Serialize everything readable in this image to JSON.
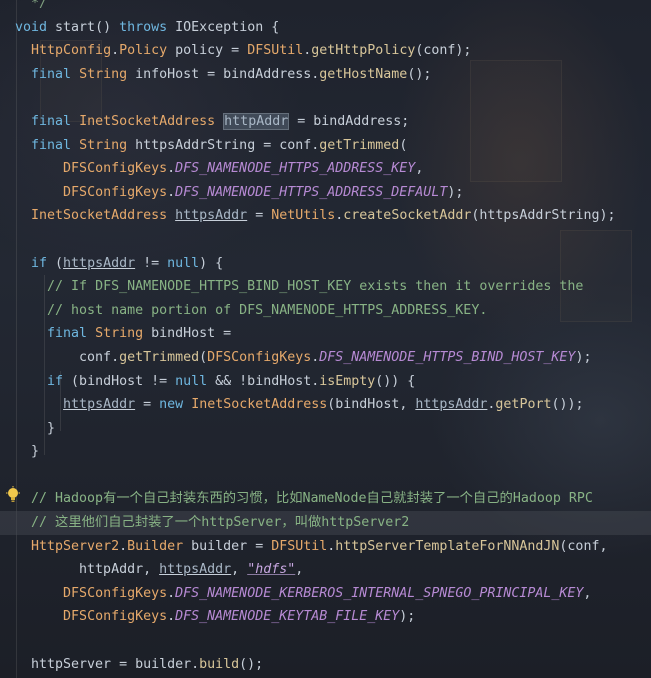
{
  "code_lines": [
    [
      {
        "t": "  */",
        "c": "cm"
      }
    ],
    [
      {
        "t": "void",
        "c": "kw"
      },
      {
        "t": " start() ",
        "c": "pl"
      },
      {
        "t": "throws",
        "c": "kw"
      },
      {
        "t": " IOException {",
        "c": "pl"
      }
    ],
    [
      {
        "t": "  ",
        "c": "pl"
      },
      {
        "t": "HttpConfig",
        "c": "ty"
      },
      {
        "t": ".",
        "c": "pl"
      },
      {
        "t": "Policy",
        "c": "ty"
      },
      {
        "t": " policy = ",
        "c": "pl"
      },
      {
        "t": "DFSUtil",
        "c": "ty"
      },
      {
        "t": ".",
        "c": "pl"
      },
      {
        "t": "getHttpPolicy",
        "c": "fn"
      },
      {
        "t": "(conf);",
        "c": "pl"
      }
    ],
    [
      {
        "t": "  ",
        "c": "pl"
      },
      {
        "t": "final",
        "c": "kw"
      },
      {
        "t": " ",
        "c": "pl"
      },
      {
        "t": "String",
        "c": "ty"
      },
      {
        "t": " infoHost = bindAddress.",
        "c": "pl"
      },
      {
        "t": "getHostName",
        "c": "fn"
      },
      {
        "t": "();",
        "c": "pl"
      }
    ],
    [
      {
        "t": "",
        "c": "pl"
      }
    ],
    [
      {
        "t": "  ",
        "c": "pl"
      },
      {
        "t": "final",
        "c": "kw"
      },
      {
        "t": " ",
        "c": "pl"
      },
      {
        "t": "InetSocketAddress",
        "c": "ty"
      },
      {
        "t": " ",
        "c": "pl"
      },
      {
        "t": "httpAddr",
        "c": "hl"
      },
      {
        "t": " = bindAddress;",
        "c": "pl"
      }
    ],
    [
      {
        "t": "  ",
        "c": "pl"
      },
      {
        "t": "final",
        "c": "kw"
      },
      {
        "t": " ",
        "c": "pl"
      },
      {
        "t": "String",
        "c": "ty"
      },
      {
        "t": " httpsAddrString = conf.",
        "c": "pl"
      },
      {
        "t": "getTrimmed",
        "c": "fn"
      },
      {
        "t": "(",
        "c": "pl"
      }
    ],
    [
      {
        "t": "      ",
        "c": "pl"
      },
      {
        "t": "DFSConfigKeys",
        "c": "ty"
      },
      {
        "t": ".",
        "c": "pl"
      },
      {
        "t": "DFS_NAMENODE_HTTPS_ADDRESS_KEY",
        "c": "cf"
      },
      {
        "t": ",",
        "c": "pl"
      }
    ],
    [
      {
        "t": "      ",
        "c": "pl"
      },
      {
        "t": "DFSConfigKeys",
        "c": "ty"
      },
      {
        "t": ".",
        "c": "pl"
      },
      {
        "t": "DFS_NAMENODE_HTTPS_ADDRESS_DEFAULT",
        "c": "cf"
      },
      {
        "t": ");",
        "c": "pl"
      }
    ],
    [
      {
        "t": "  ",
        "c": "pl"
      },
      {
        "t": "InetSocketAddress",
        "c": "ty"
      },
      {
        "t": " ",
        "c": "pl"
      },
      {
        "t": "httpsAddr",
        "c": "ul"
      },
      {
        "t": " = ",
        "c": "pl"
      },
      {
        "t": "NetUtils",
        "c": "ty"
      },
      {
        "t": ".",
        "c": "pl"
      },
      {
        "t": "createSocketAddr",
        "c": "fn"
      },
      {
        "t": "(httpsAddrString);",
        "c": "pl"
      }
    ],
    [
      {
        "t": "",
        "c": "pl"
      }
    ],
    [
      {
        "t": "  ",
        "c": "pl"
      },
      {
        "t": "if",
        "c": "kw"
      },
      {
        "t": " (",
        "c": "pl"
      },
      {
        "t": "httpsAddr",
        "c": "ul"
      },
      {
        "t": " != ",
        "c": "pl"
      },
      {
        "t": "null",
        "c": "nl"
      },
      {
        "t": ") {",
        "c": "pl"
      }
    ],
    [
      {
        "t": "    ",
        "c": "pl"
      },
      {
        "t": "// If DFS_NAMENODE_HTTPS_BIND_HOST_KEY exists then it overrides the",
        "c": "cmc"
      }
    ],
    [
      {
        "t": "    ",
        "c": "pl"
      },
      {
        "t": "// host name portion of DFS_NAMENODE_HTTPS_ADDRESS_KEY.",
        "c": "cmc"
      }
    ],
    [
      {
        "t": "    ",
        "c": "pl"
      },
      {
        "t": "final",
        "c": "kw"
      },
      {
        "t": " ",
        "c": "pl"
      },
      {
        "t": "String",
        "c": "ty"
      },
      {
        "t": " bindHost =",
        "c": "pl"
      }
    ],
    [
      {
        "t": "        conf.",
        "c": "pl"
      },
      {
        "t": "getTrimmed",
        "c": "fn"
      },
      {
        "t": "(",
        "c": "pl"
      },
      {
        "t": "DFSConfigKeys",
        "c": "ty"
      },
      {
        "t": ".",
        "c": "pl"
      },
      {
        "t": "DFS_NAMENODE_HTTPS_BIND_HOST_KEY",
        "c": "cf"
      },
      {
        "t": ");",
        "c": "pl"
      }
    ],
    [
      {
        "t": "    ",
        "c": "pl"
      },
      {
        "t": "if",
        "c": "kw"
      },
      {
        "t": " (bindHost != ",
        "c": "pl"
      },
      {
        "t": "null",
        "c": "nl"
      },
      {
        "t": " && !bindHost.",
        "c": "pl"
      },
      {
        "t": "isEmpty",
        "c": "fn"
      },
      {
        "t": "()) {",
        "c": "pl"
      }
    ],
    [
      {
        "t": "      ",
        "c": "pl"
      },
      {
        "t": "httpsAddr",
        "c": "ul"
      },
      {
        "t": " = ",
        "c": "pl"
      },
      {
        "t": "new",
        "c": "kw"
      },
      {
        "t": " ",
        "c": "pl"
      },
      {
        "t": "InetSocketAddress",
        "c": "ty"
      },
      {
        "t": "(bindHost, ",
        "c": "pl"
      },
      {
        "t": "httpsAddr",
        "c": "ul"
      },
      {
        "t": ".",
        "c": "pl"
      },
      {
        "t": "getPort",
        "c": "fn"
      },
      {
        "t": "());",
        "c": "pl"
      }
    ],
    [
      {
        "t": "    }",
        "c": "pl"
      }
    ],
    [
      {
        "t": "  }",
        "c": "pl"
      }
    ],
    [
      {
        "t": "",
        "c": "pl"
      }
    ],
    [
      {
        "t": "  ",
        "c": "pl"
      },
      {
        "t": "// Hadoop有一个自己封装东西的习惯，比如NameNode自己就封装了一个自己的Hadoop RPC",
        "c": "cmc"
      }
    ],
    [
      {
        "t": "  ",
        "c": "pl"
      },
      {
        "t": "// 这里他们自己封装了一个httpServer，叫做httpServer2",
        "c": "cmc"
      }
    ],
    [
      {
        "t": "  ",
        "c": "pl"
      },
      {
        "t": "HttpServer2",
        "c": "ty"
      },
      {
        "t": ".",
        "c": "pl"
      },
      {
        "t": "Builder",
        "c": "ty"
      },
      {
        "t": " builder = ",
        "c": "pl"
      },
      {
        "t": "DFSUtil",
        "c": "ty"
      },
      {
        "t": ".",
        "c": "pl"
      },
      {
        "t": "httpServerTemplateForNNAndJN",
        "c": "fn"
      },
      {
        "t": "(conf,",
        "c": "pl"
      }
    ],
    [
      {
        "t": "        httpAddr, ",
        "c": "pl"
      },
      {
        "t": "httpsAddr",
        "c": "ul"
      },
      {
        "t": ", ",
        "c": "pl"
      },
      {
        "t": "\"hdfs\"",
        "c": "str"
      },
      {
        "t": ",",
        "c": "pl"
      }
    ],
    [
      {
        "t": "      ",
        "c": "pl"
      },
      {
        "t": "DFSConfigKeys",
        "c": "ty"
      },
      {
        "t": ".",
        "c": "pl"
      },
      {
        "t": "DFS_NAMENODE_KERBEROS_INTERNAL_SPNEGO_PRINCIPAL_KEY",
        "c": "cf"
      },
      {
        "t": ",",
        "c": "pl"
      }
    ],
    [
      {
        "t": "      ",
        "c": "pl"
      },
      {
        "t": "DFSConfigKeys",
        "c": "ty"
      },
      {
        "t": ".",
        "c": "pl"
      },
      {
        "t": "DFS_NAMENODE_KEYTAB_FILE_KEY",
        "c": "cf"
      },
      {
        "t": ");",
        "c": "pl"
      }
    ],
    [
      {
        "t": "",
        "c": "pl"
      }
    ],
    [
      {
        "t": "  httpServer = builder.",
        "c": "pl"
      },
      {
        "t": "build",
        "c": "fn"
      },
      {
        "t": "();",
        "c": "pl"
      }
    ]
  ],
  "current_line_index": 22,
  "gutter_icon": "lightbulb-icon",
  "colors": {
    "keyword": "#6fb7e0",
    "type": "#e6a96b",
    "method": "#d8c69a",
    "constant": "#b78ad4",
    "comment": "#88b385",
    "plain": "#c7cfd9"
  }
}
